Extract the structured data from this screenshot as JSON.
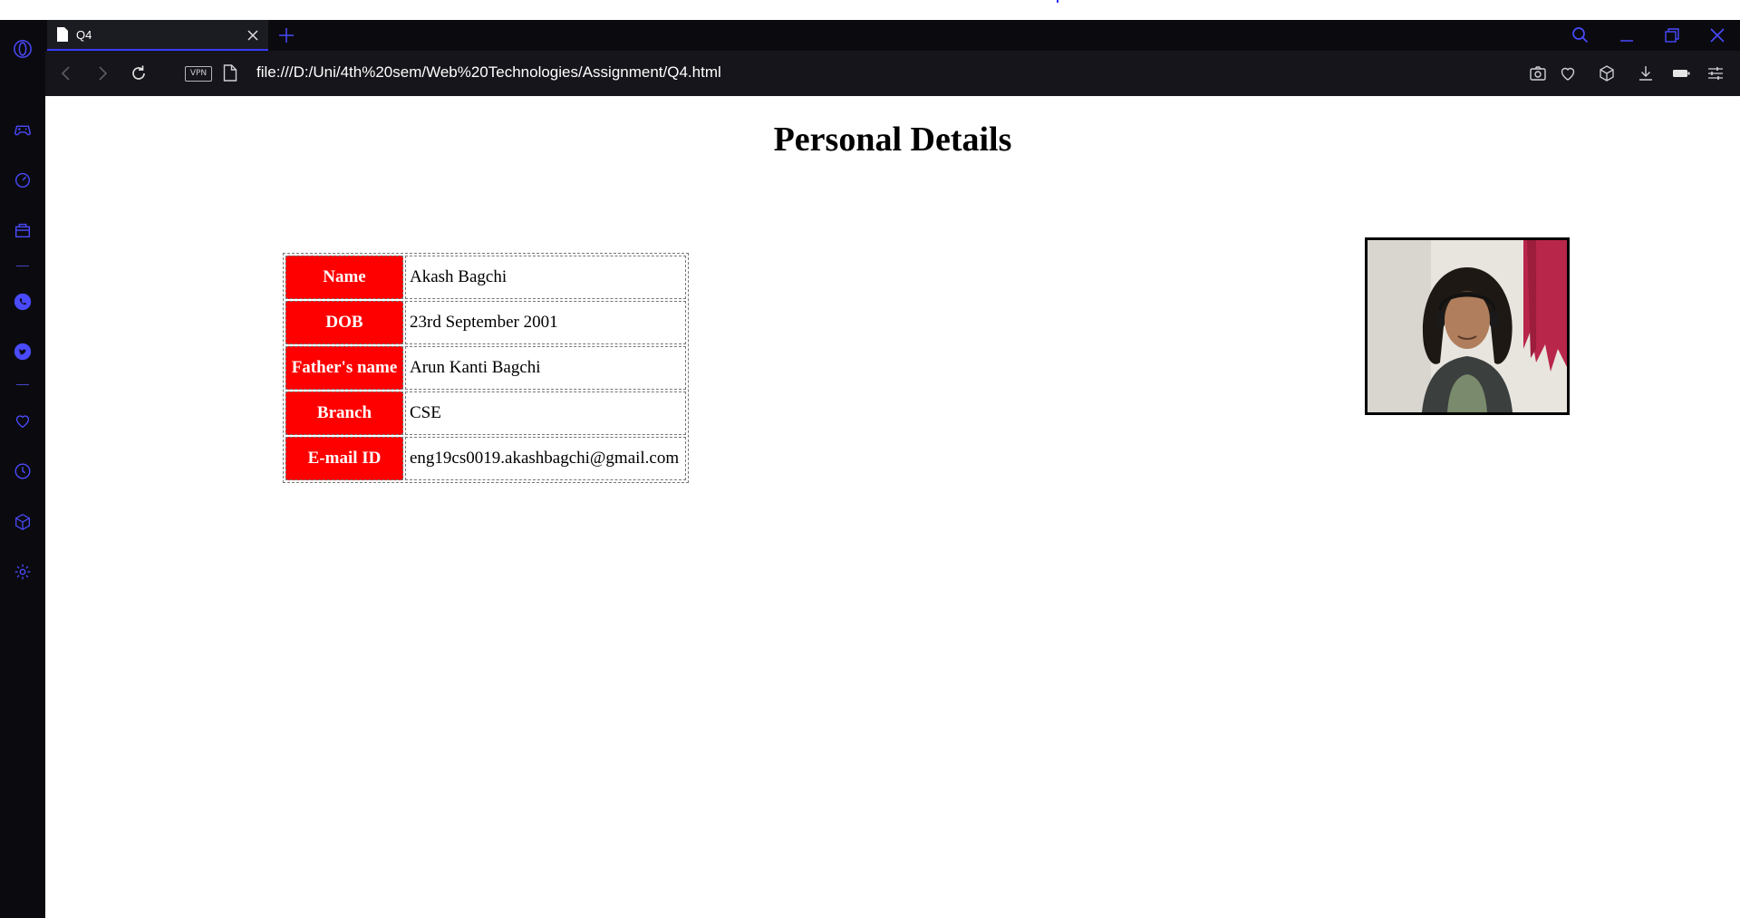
{
  "browser": {
    "tab": {
      "title": "Q4"
    },
    "address": {
      "vpn_label": "VPN",
      "url": "file:///D:/Uni/4th%20sem/Web%20Technologies/Assignment/Q4.html"
    }
  },
  "colors": {
    "accent": "#3b3bff",
    "chrome_bg": "#0b0b0f",
    "header_cell": "#ff0000"
  },
  "sidebar": {
    "icons": [
      "game-controller-icon",
      "speed-dial-icon",
      "shopping-bag-icon",
      "whatsapp-icon",
      "twitter-icon",
      "heart-icon",
      "history-clock-icon",
      "cube-icon",
      "settings-gear-icon"
    ]
  },
  "page": {
    "title": "Personal Details",
    "rows": [
      {
        "key": "Name",
        "value": "Akash Bagchi"
      },
      {
        "key": "DOB",
        "value": "23rd September 2001"
      },
      {
        "key": "Father's name",
        "value": "Arun Kanti Bagchi"
      },
      {
        "key": "Branch",
        "value": "CSE"
      },
      {
        "key": "E-mail ID",
        "value": "eng19cs0019.akashbagchi@gmail.com"
      }
    ]
  }
}
